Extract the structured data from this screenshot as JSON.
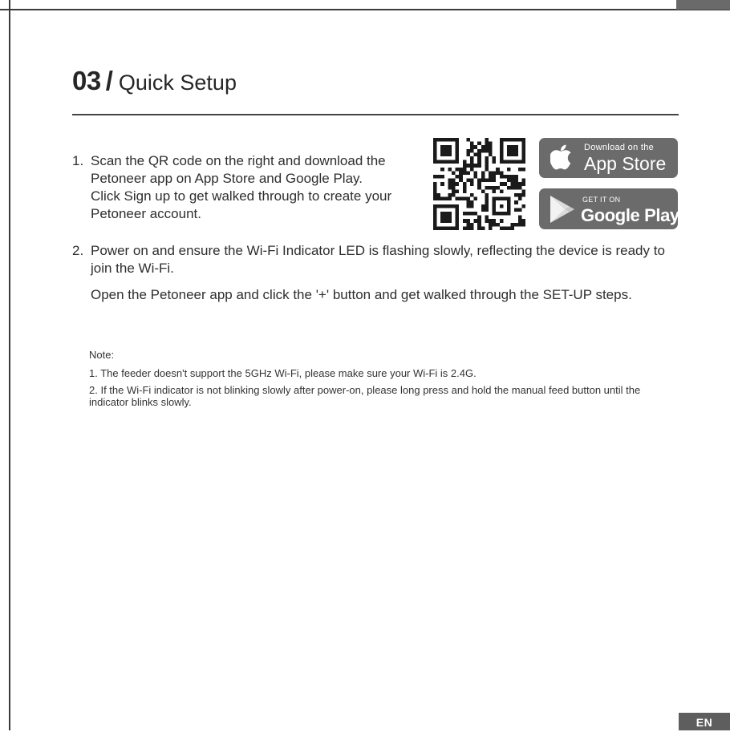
{
  "section": {
    "number": "03",
    "slash": "/",
    "title": "Quick Setup"
  },
  "steps": [
    {
      "number": "1.",
      "lines": [
        "Scan the QR code on the right and download the",
        "Petoneer app on App Store and Google Play.",
        "Click Sign up to get walked through to create your",
        "Petoneer account."
      ]
    },
    {
      "number": "2.",
      "paragraph1": "Power on and ensure the Wi-Fi Indicator LED is flashing slowly, reflecting the device is ready to join the Wi-Fi.",
      "paragraph2": "Open the Petoneer app and click the '+' button and get walked through the SET-UP steps."
    }
  ],
  "badges": {
    "appstore": {
      "small": "Download on the",
      "big": "App Store",
      "icon": "apple-icon"
    },
    "google": {
      "small": "GET IT ON",
      "big": "Google Play",
      "icon": "play-icon"
    }
  },
  "note": {
    "heading": "Note:",
    "items": [
      "1. The feeder doesn't support the 5GHz Wi-Fi, please make sure your Wi-Fi is 2.4G.",
      "2. If the Wi-Fi indicator is not blinking slowly after power-on, please long press and hold the manual feed button until the indicator blinks slowly."
    ]
  },
  "language_tab": "EN",
  "colors": {
    "badge_bg": "#6b6b6b",
    "text": "#2e2e2e",
    "rule": "#444444"
  }
}
